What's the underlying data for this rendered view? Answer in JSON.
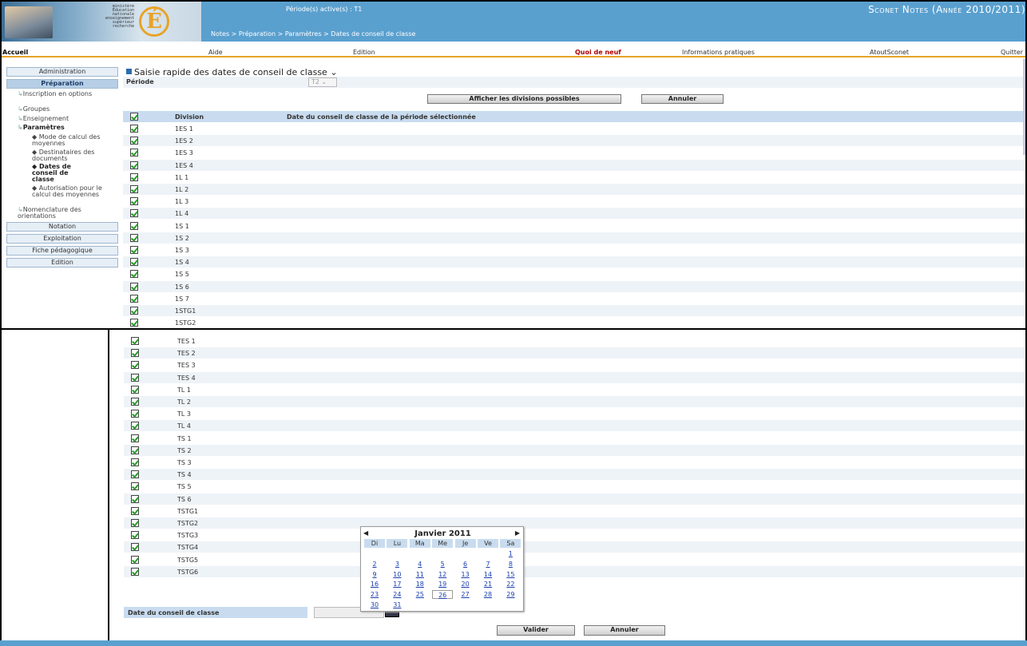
{
  "header": {
    "logo_lines": [
      "ministère",
      "Éducation",
      "nationale",
      "enseignement",
      "supérieur",
      "recherche"
    ],
    "logo_letter": "É",
    "periode": "Période(s) active(s) : T1",
    "breadcrumb": "Notes > Préparation > Paramètres > Dates de conseil de classe",
    "app_title": "Sconet Notes (Année 2010/2011)"
  },
  "menubar": [
    "Accueil",
    "Aide",
    "Edition",
    "Quoi de neuf",
    "Informations pratiques",
    "AtoutSconet",
    "Quitter"
  ],
  "nav": {
    "administration": "Administration",
    "preparation": "Préparation",
    "sub": [
      "Inscription en options",
      "Groupes",
      "Enseignement",
      "Paramètres"
    ],
    "params": [
      "Mode de calcul des moyennes",
      "Destinataires des documents",
      "Dates de conseil de classe",
      "Autorisation pour le calcul des moyennes"
    ],
    "nomenclature": "Nomenclature des orientations",
    "notation": "Notation",
    "exploitation": "Exploitation",
    "fiche": "Fiche pédagogique",
    "edition": "Edition"
  },
  "main": {
    "title": "Saisie rapide des dates de conseil de classe",
    "periode_label": "Période",
    "periode_value": "T2",
    "afficher_button": "Afficher les divisions possibles",
    "annuler_button": "Annuler",
    "col_division": "Division",
    "col_date": "Date du conseil de classe de la période sélectionnée",
    "divisions_top": [
      "1ES 1",
      "1ES 2",
      "1ES 3",
      "1ES 4",
      "1L 1",
      "1L 2",
      "1L 3",
      "1L 4",
      "1S 1",
      "1S 2",
      "1S 3",
      "1S 4",
      "1S 5",
      "1S 6",
      "1S 7",
      "1STG1",
      "1STG2"
    ],
    "divisions_bottom": [
      "TES 1",
      "TES 2",
      "TES 3",
      "TES 4",
      "TL 1",
      "TL 2",
      "TL 3",
      "TL 4",
      "TS 1",
      "TS 2",
      "TS 3",
      "TS 4",
      "TS 5",
      "TS 6",
      "TSTG1",
      "TSTG2",
      "TSTG3",
      "TSTG4",
      "TSTG5",
      "TSTG6"
    ],
    "date_label": "Date du conseil de classe",
    "valider_button": "Valider",
    "annuler_bottom": "Annuler"
  },
  "calendar": {
    "month": "Janvier 2011",
    "days_of_week": [
      "Di",
      "Lu",
      "Ma",
      "Me",
      "Je",
      "Ve",
      "Sa"
    ],
    "first_weekday": 6,
    "num_days": 31,
    "highlight_day": 26
  }
}
